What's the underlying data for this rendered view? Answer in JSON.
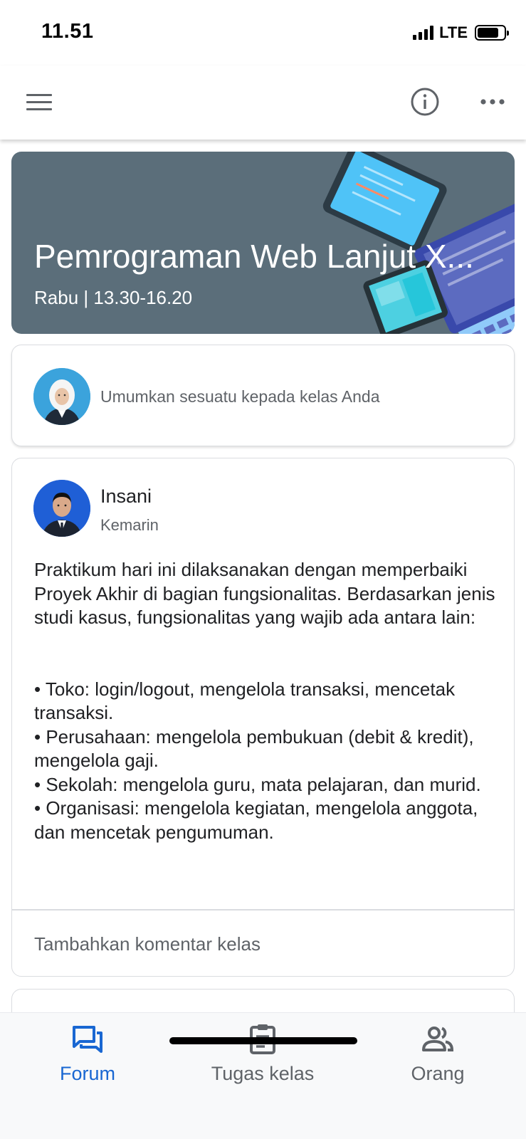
{
  "status_bar": {
    "time": "11.51",
    "network": "LTE",
    "battery_level": 0.8
  },
  "app_bar": {
    "icons": [
      "menu-icon",
      "info-icon",
      "more-icon"
    ]
  },
  "banner": {
    "title": "Pemrograman Web Lanjut X...",
    "subtitle": "Rabu | 13.30-16.20",
    "background_color": "#5b6e7a"
  },
  "announce": {
    "placeholder": "Umumkan sesuatu kepada kelas Anda"
  },
  "post": {
    "author": "Insani",
    "date": "Kemarin",
    "intro": "Praktikum hari ini dilaksanakan dengan memperbaiki Proyek Akhir di bagian fungsionalitas. Berdasarkan jenis studi kasus, fungsionalitas yang wajib ada antara lain:",
    "bullets": [
      "• Toko: login/logout, mengelola transaksi, mencetak transaksi.",
      "• Perusahaan: mengelola pembukuan (debit & kredit), mengelola gaji.",
      "• Sekolah: mengelola guru, mata pelajaran, dan murid.",
      "• Organisasi: mengelola kegiatan, mengelola anggota, dan mencetak pengumuman."
    ],
    "comment_placeholder": "Tambahkan komentar kelas"
  },
  "bottom_nav": {
    "items": [
      {
        "label": "Forum",
        "icon": "forum-icon",
        "active": true
      },
      {
        "label": "Tugas kelas",
        "icon": "classwork-icon",
        "active": false
      },
      {
        "label": "Orang",
        "icon": "people-icon",
        "active": false
      }
    ],
    "active_color": "#1967d2",
    "inactive_color": "#5f6368"
  }
}
